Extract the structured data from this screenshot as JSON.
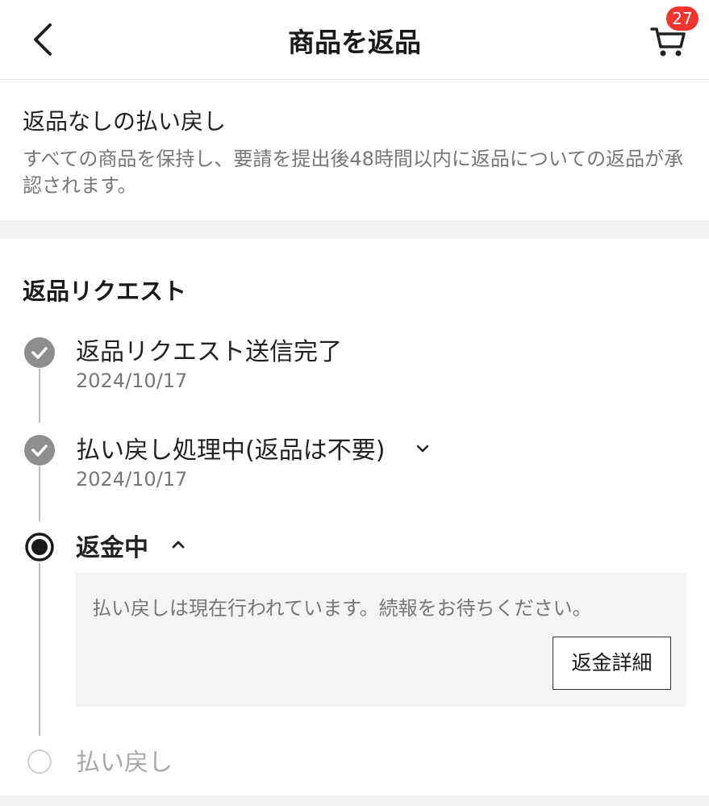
{
  "header": {
    "title": "商品を返品",
    "cart_count": "27",
    "icons": {
      "back": "chevron-left-icon",
      "cart": "cart-icon"
    }
  },
  "info": {
    "title": "返品なしの払い戻し",
    "description": "すべての商品を保持し、要請を提出後48時間以内に返品についての返品が承認されます。"
  },
  "section": {
    "title": "返品リクエスト"
  },
  "steps": [
    {
      "title": "返品リクエスト送信完了",
      "date": "2024/10/17",
      "status": "done"
    },
    {
      "title": "払い戻し処理中(返品は不要)",
      "date": "2024/10/17",
      "status": "done",
      "expanded": false
    },
    {
      "title": "返金中",
      "status": "active",
      "expanded": true,
      "detail": {
        "text": "払い戻しは現在行われています。続報をお待ちください。",
        "button": "返金詳細"
      }
    },
    {
      "title": "払い戻し",
      "status": "pending"
    }
  ],
  "colors": {
    "badge": "#f2362f",
    "done_dot": "#8e8e8e",
    "active_dot": "#1a1a1a",
    "pending_dot": "#cfcfcf"
  }
}
